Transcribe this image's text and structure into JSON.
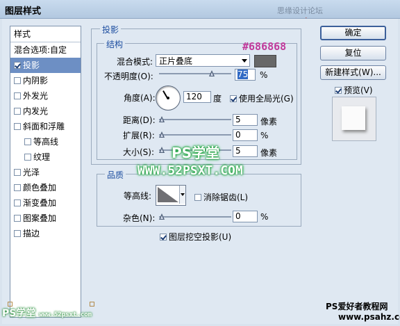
{
  "window": {
    "title": "图层样式",
    "watermark_top_site": "思缘设计论坛",
    "watermark_top_url": "www.missyuan.com"
  },
  "sidebar": {
    "header": "样式",
    "blend_options": "混合选项:自定",
    "items": [
      {
        "label": "投影",
        "checked": true,
        "selected": true
      },
      {
        "label": "内阴影",
        "checked": false
      },
      {
        "label": "外发光",
        "checked": false
      },
      {
        "label": "内发光",
        "checked": false
      },
      {
        "label": "斜面和浮雕",
        "checked": false
      },
      {
        "label": "等高线",
        "checked": false,
        "indent": true
      },
      {
        "label": "纹理",
        "checked": false,
        "indent": true
      },
      {
        "label": "光泽",
        "checked": false
      },
      {
        "label": "颜色叠加",
        "checked": false
      },
      {
        "label": "渐变叠加",
        "checked": false
      },
      {
        "label": "图案叠加",
        "checked": false
      },
      {
        "label": "描边",
        "checked": false
      }
    ]
  },
  "drop_shadow": {
    "section_title": "投影",
    "structure_title": "结构",
    "blend_mode_label": "混合模式:",
    "blend_mode_value": "正片叠底",
    "color_hex_note": "#686868",
    "shadow_color": "#686868",
    "opacity_label": "不透明度(O):",
    "opacity_value": "75",
    "opacity_unit": "%",
    "opacity_level": 0.75,
    "angle_label": "角度(A):",
    "angle_value": "120",
    "angle_unit": "度",
    "global_light_label": "使用全局光(G)",
    "global_light_checked": true,
    "distance_label": "距离(D):",
    "distance_value": "5",
    "distance_unit": "像素",
    "spread_label": "扩展(R):",
    "spread_value": "0",
    "spread_unit": "%",
    "size_label": "大小(S):",
    "size_value": "5",
    "size_unit": "像素"
  },
  "quality": {
    "title": "品质",
    "contour_label": "等高线:",
    "antialias_label": "消除锯齿(L)",
    "antialias_checked": false,
    "noise_label": "杂色(N):",
    "noise_value": "0",
    "noise_unit": "%",
    "knockout_label": "图层挖空投影(U)",
    "knockout_checked": true
  },
  "buttons": {
    "ok": "确定",
    "reset": "复位",
    "new_style": "新建样式(W)...",
    "preview_label": "预览(V)",
    "preview_checked": true
  },
  "watermarks": {
    "center_name": "PS学堂",
    "center_url": "WWW.52PSXT.COM",
    "bottom_left_name": "PS学堂",
    "bottom_left_url": "www.52psxt.com",
    "bottom_right_line1": "PS爱好者教程网",
    "bottom_right_line2": "www.psahz.com"
  }
}
